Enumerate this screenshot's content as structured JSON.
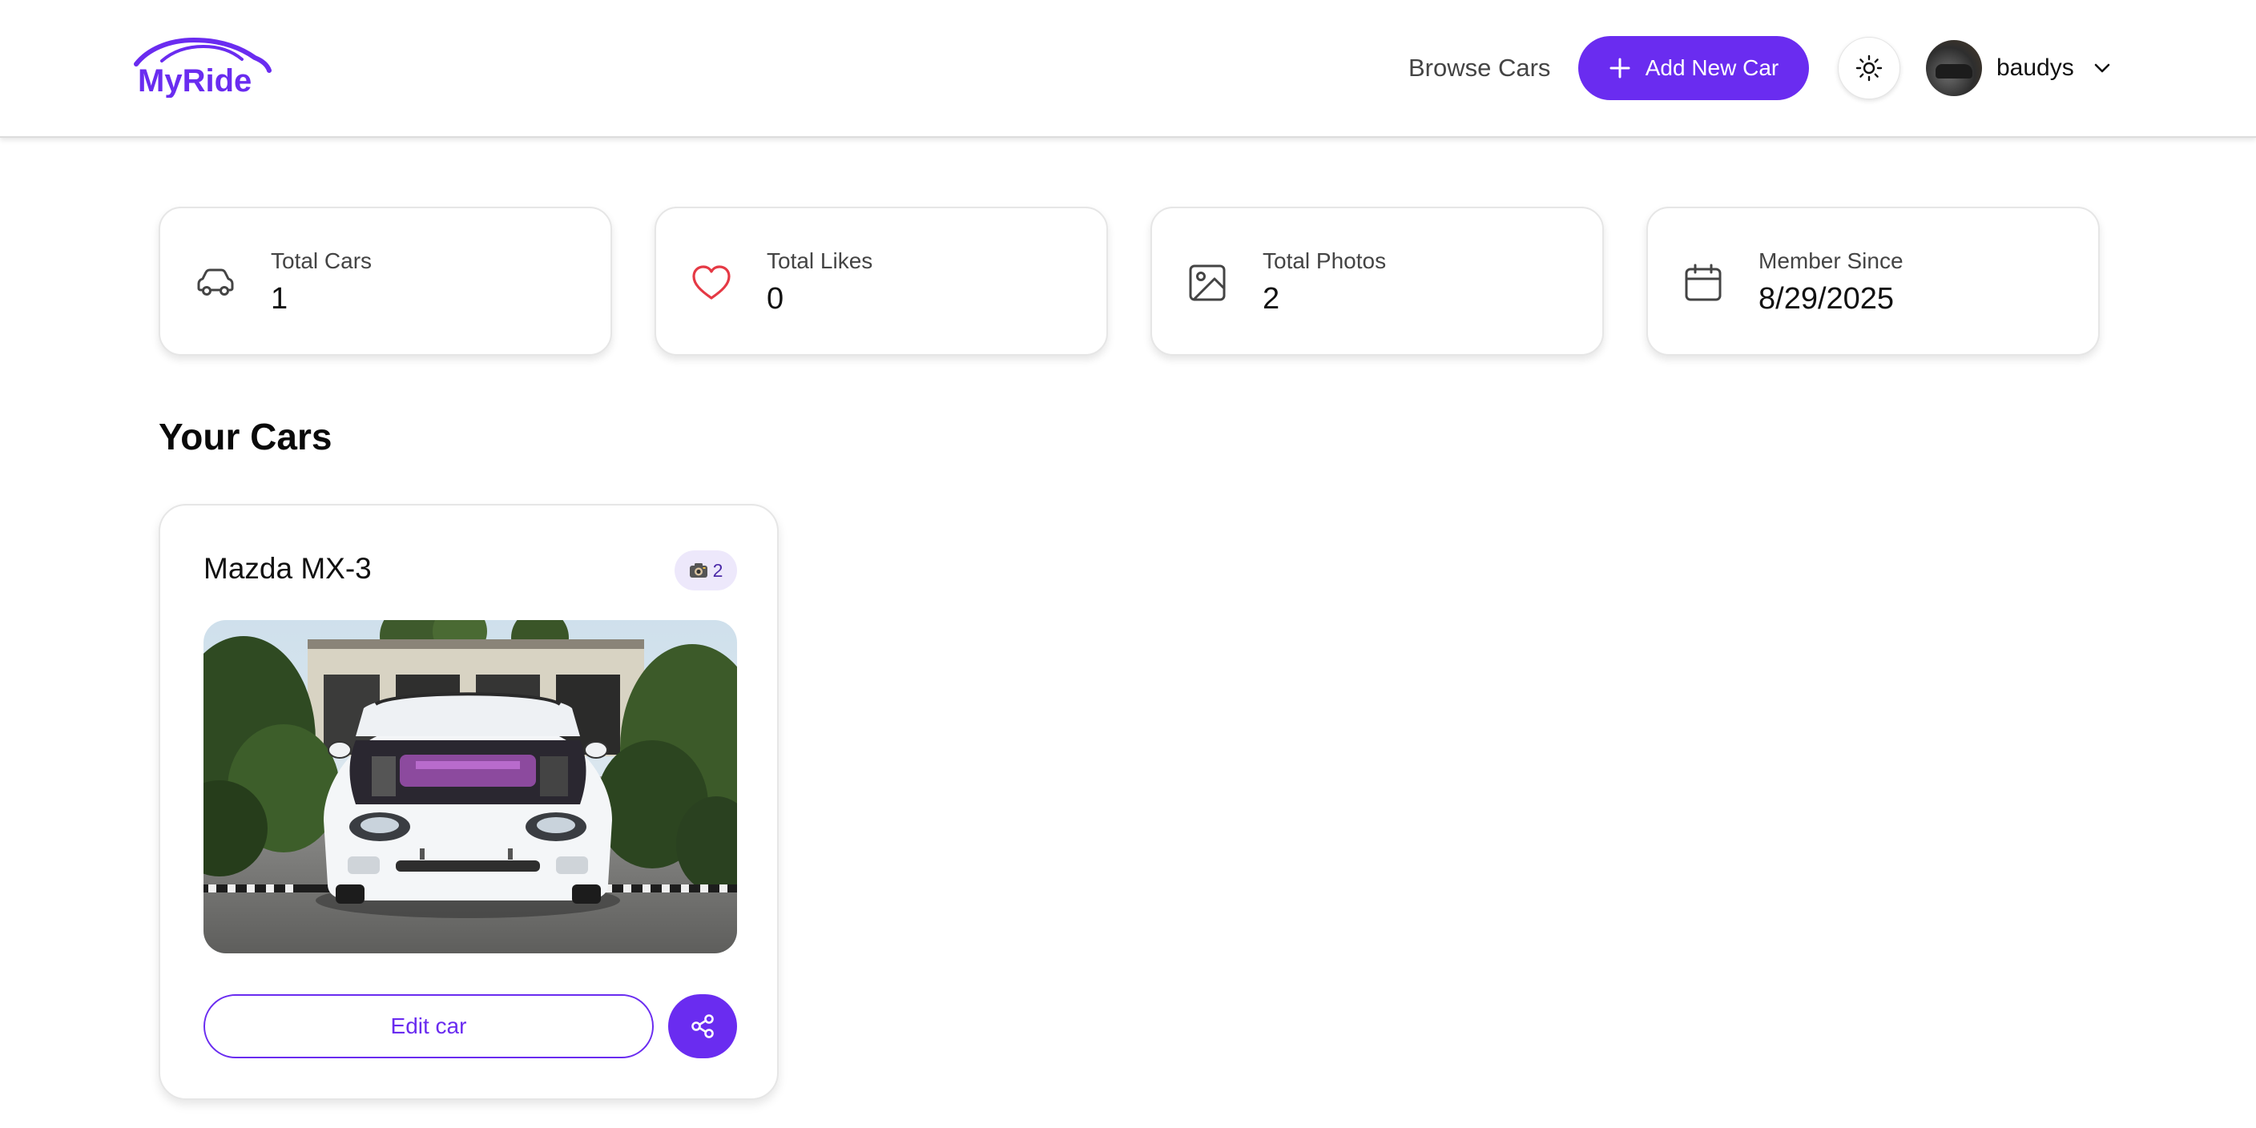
{
  "header": {
    "logo_text": "MyRide",
    "nav_browse_label": "Browse Cars",
    "add_car_label": "Add New Car",
    "username": "baudys"
  },
  "stats": [
    {
      "label": "Total Cars",
      "value": "1",
      "icon": "car-icon"
    },
    {
      "label": "Total Likes",
      "value": "0",
      "icon": "heart-icon"
    },
    {
      "label": "Total Photos",
      "value": "2",
      "icon": "image-icon"
    },
    {
      "label": "Member Since",
      "value": "8/29/2025",
      "icon": "calendar-icon"
    }
  ],
  "section": {
    "title": "Your Cars"
  },
  "cars": [
    {
      "name": "Mazda MX-3",
      "photo_count": "2",
      "badge_icon": "camera-icon",
      "edit_label": "Edit car",
      "share_icon": "share-icon"
    }
  ],
  "colors": {
    "accent": "#6a2cf0",
    "heart": "#e53945",
    "badge_bg": "#ede8fb"
  }
}
